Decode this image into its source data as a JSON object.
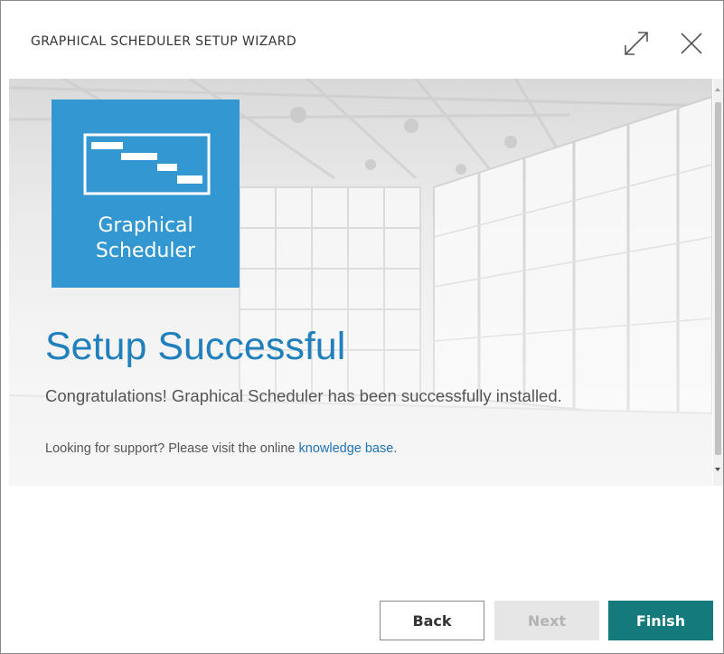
{
  "window": {
    "title": "GRAPHICAL SCHEDULER SETUP WIZARD",
    "expand_icon": "expand-icon",
    "close_icon": "close-icon"
  },
  "banner": {
    "logo_text": "Graphical\nScheduler",
    "logo_color": "#3398d1"
  },
  "main": {
    "heading": "Setup Successful",
    "message": "Congratulations! Graphical Scheduler has been successfully installed.",
    "support_prefix": "Looking for support? Please visit the online ",
    "support_link": "knowledge base",
    "support_suffix": "."
  },
  "footer": {
    "back_label": "Back",
    "next_label": "Next",
    "finish_label": "Finish"
  },
  "colors": {
    "heading": "#1f80bd",
    "link": "#1f72b8",
    "finish_button": "#157a7c"
  }
}
